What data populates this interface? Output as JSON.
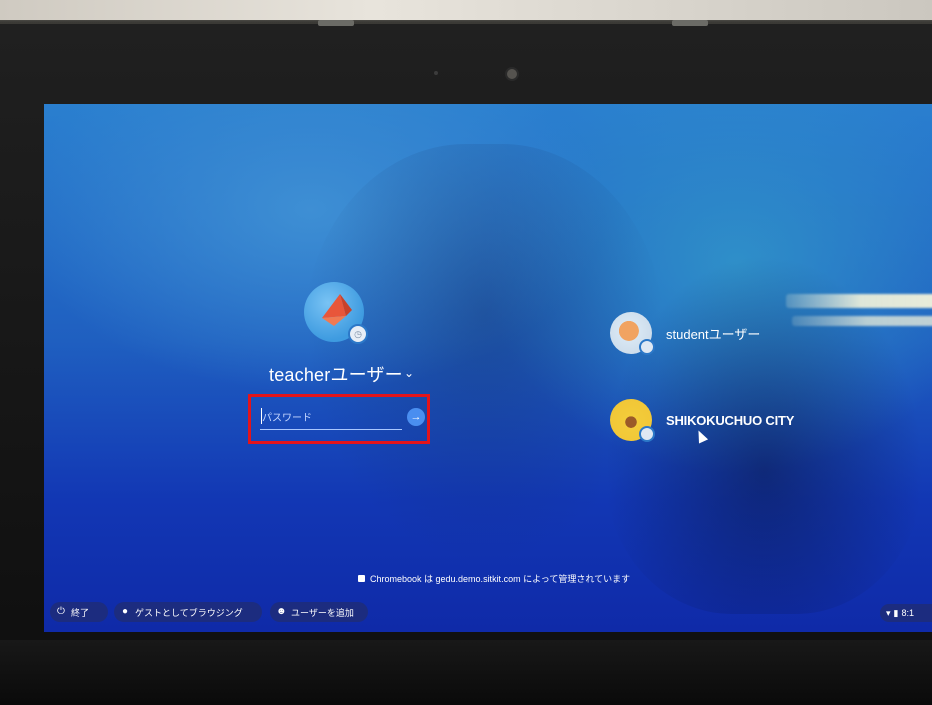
{
  "login": {
    "main_user": {
      "name": "teacherユーザー",
      "chevron": "⌄"
    },
    "password": {
      "placeholder": "パスワード",
      "value": ""
    },
    "submit_icon": "→"
  },
  "user_pods": [
    {
      "name": "studentユーザー"
    },
    {
      "name": "SHIKOKUCHUO CITY"
    }
  ],
  "managed_note": "Chromebook は gedu.demo.sitkit.com によって管理されています",
  "shelf": {
    "shutdown_label": "終了",
    "guest_label": "ゲストとしてブラウジング",
    "add_user_label": "ユーザーを追加",
    "time": "8:1"
  },
  "colors": {
    "highlight": "#e3141b",
    "screen_top": "#2a7fcf",
    "screen_bottom": "#0f2aa8"
  }
}
